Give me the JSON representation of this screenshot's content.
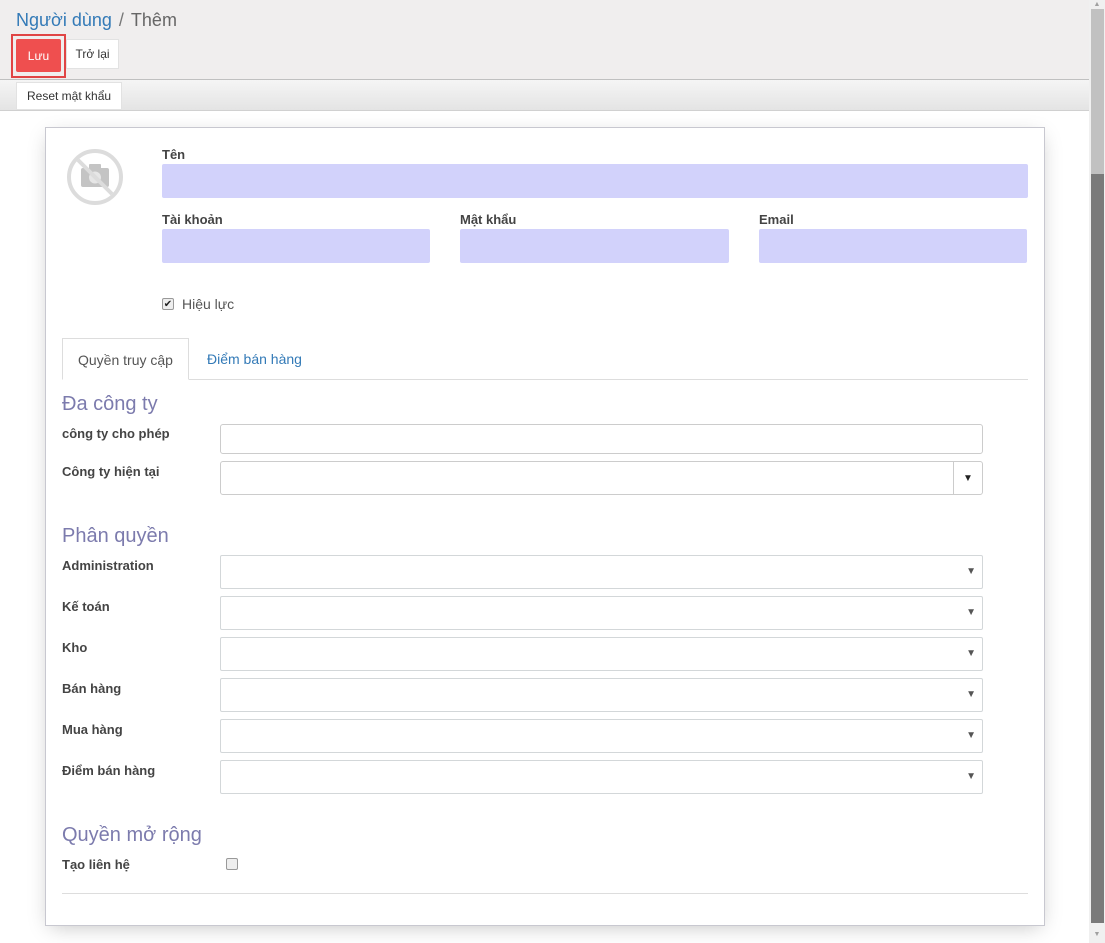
{
  "breadcrumb": {
    "parent": "Người dùng",
    "separator": "/",
    "current": "Thêm"
  },
  "toolbar": {
    "save_label": "Lưu",
    "back_label": "Trở lại",
    "reset_password_label": "Reset mật khẩu"
  },
  "colors": {
    "save_button": "#ef4f4f",
    "required_field": "#d2d2fb",
    "group_title": "#7c7bad",
    "link": "#337ab7"
  },
  "form": {
    "avatar_icon": "no-photo-camera-icon",
    "name": {
      "label": "Tên",
      "value": ""
    },
    "login": {
      "label": "Tài khoản",
      "value": ""
    },
    "password": {
      "label": "Mật khẩu",
      "value": ""
    },
    "email": {
      "label": "Email",
      "value": ""
    },
    "active": {
      "label": "Hiệu lực",
      "checked": true
    }
  },
  "tabs": [
    {
      "label": "Quyền truy cập",
      "active": true
    },
    {
      "label": "Điểm bán hàng",
      "active": false
    }
  ],
  "groups": {
    "multi_company": {
      "title": "Đa công ty",
      "allowed_companies": {
        "label": "công ty cho phép",
        "value": ""
      },
      "current_company": {
        "label": "Công ty hiện tại",
        "value": ""
      }
    },
    "access_rights": {
      "title": "Phân quyền",
      "rows": [
        {
          "label": "Administration",
          "value": ""
        },
        {
          "label": "Kế toán",
          "value": ""
        },
        {
          "label": "Kho",
          "value": ""
        },
        {
          "label": "Bán hàng",
          "value": ""
        },
        {
          "label": "Mua hàng",
          "value": ""
        },
        {
          "label": "Điểm bán hàng",
          "value": ""
        }
      ]
    },
    "extra_rights": {
      "title": "Quyền mở rộng",
      "create_contact": {
        "label": "Tạo liên hệ",
        "checked": false
      }
    }
  },
  "icons": {
    "caret": "▼",
    "check": "✔",
    "scroll_up": "▲",
    "scroll_down": "▼"
  }
}
